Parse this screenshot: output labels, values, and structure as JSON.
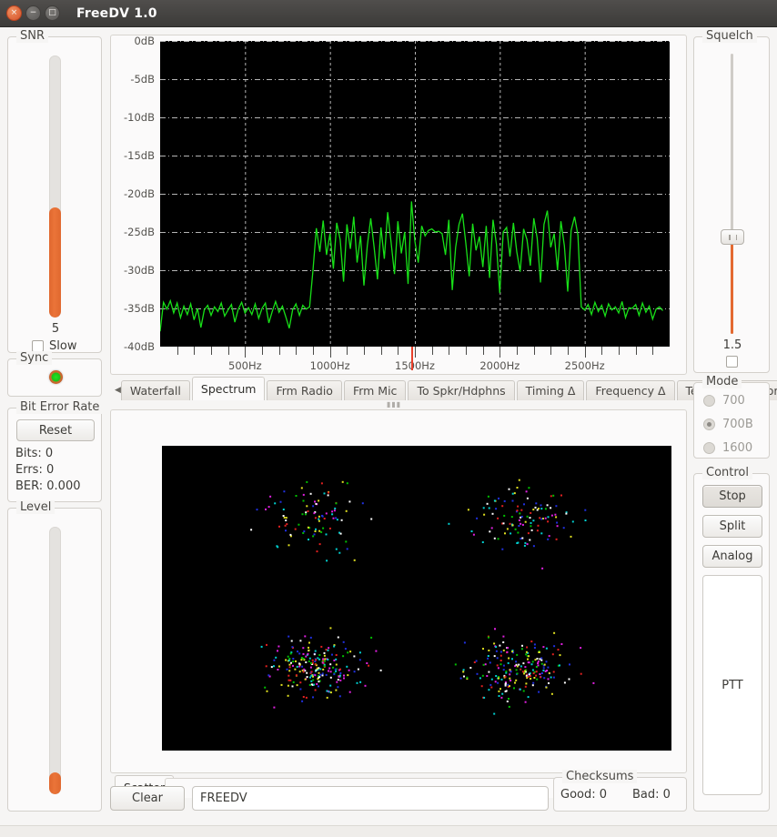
{
  "window": {
    "title": "FreeDV 1.0",
    "close_icon": "close-icon",
    "minimize_icon": "minimize-icon",
    "maximize_icon": "maximize-icon",
    "close_glyph": "×",
    "minimize_glyph": "−",
    "maximize_glyph": "□"
  },
  "snr": {
    "title": "SNR",
    "value": "5",
    "slow_label": "Slow",
    "slow_checked": false,
    "fill_percent": 42,
    "fill_color": "#ea7438"
  },
  "sync": {
    "title": "Sync",
    "led_state": "on",
    "led_color": "#1ed01e"
  },
  "ber": {
    "title": "Bit Error Rate",
    "reset_label": "Reset",
    "bits_label": "Bits: 0",
    "errs_label": "Errs: 0",
    "ber_label": "BER: 0.000"
  },
  "level": {
    "title": "Level",
    "fill_percent": 8,
    "fill_color": "#ea7438"
  },
  "squelch": {
    "title": "Squelch",
    "value": "1.5",
    "enabled_checked": false,
    "handle_percent": 65,
    "fill_color": "#e46a31"
  },
  "mode": {
    "title": "Mode",
    "options": [
      {
        "label": "700",
        "selected": false
      },
      {
        "label": "700B",
        "selected": true
      },
      {
        "label": "1600",
        "selected": false
      }
    ]
  },
  "control": {
    "title": "Control",
    "stop_label": "Stop",
    "split_label": "Split",
    "analog_label": "Analog",
    "ptt_label": "PTT"
  },
  "spectrum_tabs": {
    "left_arrow": "◀",
    "right_arrow": "▶",
    "items": [
      {
        "label": "Waterfall",
        "selected": false
      },
      {
        "label": "Spectrum",
        "selected": true
      },
      {
        "label": "Frm Radio",
        "selected": false
      },
      {
        "label": "Frm Mic",
        "selected": false
      },
      {
        "label": "To Spkr/Hdphns",
        "selected": false
      },
      {
        "label": "Timing Δ",
        "selected": false
      },
      {
        "label": "Frequency Δ",
        "selected": false
      },
      {
        "label": "Test Frame Errors",
        "selected": false
      }
    ]
  },
  "scatter_tabs": {
    "items": [
      {
        "label": "Scatter",
        "selected": true
      }
    ]
  },
  "bottom": {
    "clear_label": "Clear",
    "callsign_value": "FREEDV",
    "callsign_placeholder": "",
    "checksums_title": "Checksums",
    "checksums_good": "Good: 0",
    "checksums_bad": "Bad: 0"
  },
  "chart_data": [
    {
      "type": "line",
      "name": "spectrum",
      "title": "",
      "xlabel": "",
      "ylabel": "",
      "xlim": [
        0,
        3000
      ],
      "ylim": [
        -40,
        0
      ],
      "grid": true,
      "legend": "none",
      "trace_color": "#18e018",
      "background": "#000000",
      "gridline_color": "#c9c9c9",
      "freq_marker_hz": 1480,
      "freq_marker_color": "#e8402a",
      "xticks": [
        500,
        1000,
        1500,
        2000,
        2500
      ],
      "xticklabels": [
        "500Hz",
        "1000Hz",
        "1500Hz",
        "2000Hz",
        "2500Hz"
      ],
      "yticks": [
        0,
        -5,
        -10,
        -15,
        -20,
        -25,
        -30,
        -35,
        -40
      ],
      "yticklabels": [
        "0dB",
        "-5dB",
        "-10dB",
        "-15dB",
        "-20dB",
        "-25dB",
        "-30dB",
        "-35dB",
        "-40dB"
      ],
      "x": [
        0,
        20,
        40,
        60,
        80,
        100,
        120,
        140,
        160,
        180,
        200,
        220,
        240,
        260,
        280,
        300,
        320,
        340,
        360,
        380,
        400,
        420,
        440,
        460,
        480,
        500,
        520,
        540,
        560,
        580,
        600,
        620,
        640,
        660,
        680,
        700,
        720,
        740,
        760,
        780,
        800,
        820,
        840,
        860,
        880,
        900,
        920,
        940,
        960,
        980,
        1000,
        1020,
        1040,
        1060,
        1080,
        1100,
        1120,
        1140,
        1160,
        1180,
        1200,
        1220,
        1240,
        1260,
        1280,
        1300,
        1320,
        1340,
        1360,
        1380,
        1400,
        1420,
        1440,
        1460,
        1480,
        1500,
        1520,
        1540,
        1560,
        1580,
        1600,
        1620,
        1640,
        1660,
        1680,
        1700,
        1720,
        1740,
        1760,
        1780,
        1800,
        1820,
        1840,
        1860,
        1880,
        1900,
        1920,
        1940,
        1960,
        1980,
        2000,
        2020,
        2040,
        2060,
        2080,
        2100,
        2120,
        2140,
        2160,
        2180,
        2200,
        2220,
        2240,
        2260,
        2280,
        2300,
        2320,
        2340,
        2360,
        2380,
        2400,
        2420,
        2440,
        2460,
        2480,
        2500,
        2520,
        2540,
        2560,
        2580,
        2600,
        2620,
        2640,
        2660,
        2680,
        2700,
        2720,
        2740,
        2760,
        2780,
        2800,
        2820,
        2840,
        2860,
        2880,
        2900,
        2920,
        2940,
        2960,
        2980,
        3000
      ],
      "y": [
        -38.0,
        -34.2,
        -35.1,
        -34.0,
        -35.6,
        -34.3,
        -36.2,
        -34.7,
        -35.8,
        -34.4,
        -36.5,
        -35.0,
        -37.5,
        -35.2,
        -34.6,
        -35.9,
        -34.8,
        -35.4,
        -34.3,
        -36.0,
        -35.2,
        -34.5,
        -36.8,
        -35.1,
        -34.2,
        -35.6,
        -34.9,
        -35.8,
        -34.4,
        -36.3,
        -35.0,
        -34.3,
        -36.9,
        -35.4,
        -34.1,
        -35.5,
        -34.7,
        -36.1,
        -37.6,
        -35.2,
        -34.4,
        -35.9,
        -34.6,
        -35.1,
        -34.8,
        -30.0,
        -24.5,
        -27.6,
        -23.5,
        -28.0,
        -25.2,
        -29.8,
        -23.8,
        -26.0,
        -31.5,
        -24.0,
        -27.2,
        -23.0,
        -29.0,
        -25.5,
        -32.0,
        -26.8,
        -23.2,
        -27.0,
        -31.2,
        -24.4,
        -28.5,
        -22.4,
        -26.4,
        -30.5,
        -23.6,
        -27.8,
        -25.0,
        -31.8,
        -21.0,
        -26.2,
        -29.0,
        -24.2,
        -25.5,
        -24.8,
        -24.6,
        -25.0,
        -24.9,
        -25.2,
        -28.0,
        -23.4,
        -32.6,
        -27.0,
        -24.0,
        -22.6,
        -26.5,
        -30.8,
        -23.9,
        -27.4,
        -25.6,
        -29.6,
        -24.2,
        -31.0,
        -23.4,
        -26.6,
        -33.0,
        -25.0,
        -24.4,
        -28.2,
        -23.8,
        -27.6,
        -30.2,
        -24.6,
        -26.0,
        -29.4,
        -23.2,
        -25.8,
        -31.6,
        -24.0,
        -22.2,
        -27.0,
        -25.2,
        -30.0,
        -23.6,
        -26.8,
        -32.8,
        -24.8,
        -23.0,
        -25.4,
        -34.8,
        -35.2,
        -34.5,
        -35.8,
        -34.2,
        -35.4,
        -34.6,
        -36.0,
        -34.4,
        -35.2,
        -34.8,
        -35.6,
        -34.1,
        -36.2,
        -34.9,
        -35.0,
        -34.5,
        -35.9,
        -34.3,
        -35.5,
        -34.7,
        -36.4,
        -35.1,
        -34.8,
        -35.3
      ]
    },
    {
      "type": "scatter",
      "name": "constellation",
      "title": "",
      "xlabel": "",
      "ylabel": "",
      "background": "#000000",
      "grid": false,
      "legend": "none",
      "point_colors": [
        "#ffffff",
        "#00c000",
        "#2030e0",
        "#e020e0",
        "#00d0d0",
        "#e02020",
        "#e0e020"
      ],
      "clusters": [
        {
          "cx": 0.3,
          "cy": 0.24,
          "n": 95,
          "spread_x": 0.115,
          "spread_y": 0.115,
          "label": "top-left"
        },
        {
          "cx": 0.7,
          "cy": 0.24,
          "n": 115,
          "spread_x": 0.115,
          "spread_y": 0.115,
          "label": "top-right"
        },
        {
          "cx": 0.3,
          "cy": 0.73,
          "n": 230,
          "spread_x": 0.105,
          "spread_y": 0.105,
          "label": "bottom-left"
        },
        {
          "cx": 0.7,
          "cy": 0.73,
          "n": 215,
          "spread_x": 0.115,
          "spread_y": 0.11,
          "label": "bottom-right"
        }
      ]
    }
  ]
}
